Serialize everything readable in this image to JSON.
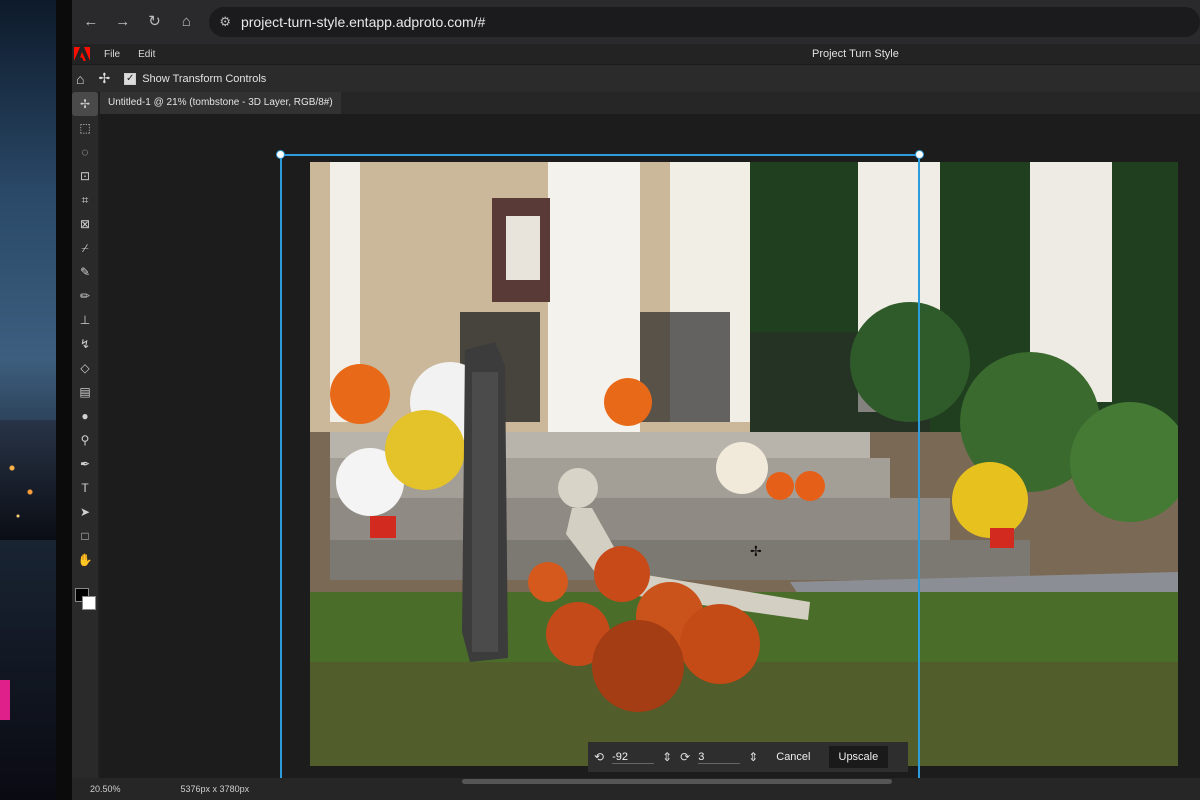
{
  "browser": {
    "url": "project-turn-style.entapp.adproto.com/#",
    "back_icon": "arrow-left-icon",
    "forward_icon": "arrow-right-icon",
    "reload_icon": "reload-icon",
    "home_icon": "home-icon"
  },
  "menubar": {
    "items": [
      {
        "label": "File"
      },
      {
        "label": "Edit"
      }
    ],
    "title": "Project Turn Style"
  },
  "options": {
    "show_transform_label": "Show Transform Controls",
    "show_transform_checked": true
  },
  "document": {
    "tab_label": "Untitled-1 @ 21% (tombstone - 3D Layer, RGB/8#)"
  },
  "tools": [
    {
      "name": "move-tool",
      "glyph": "✢"
    },
    {
      "name": "marquee-tool",
      "glyph": "⬚"
    },
    {
      "name": "lasso-tool",
      "glyph": "◌"
    },
    {
      "name": "object-select-tool",
      "glyph": "⊡"
    },
    {
      "name": "crop-tool",
      "glyph": "⌗"
    },
    {
      "name": "frame-tool",
      "glyph": "⊠"
    },
    {
      "name": "eyedropper-tool",
      "glyph": "⌿"
    },
    {
      "name": "healing-tool",
      "glyph": "✎"
    },
    {
      "name": "brush-tool",
      "glyph": "✏"
    },
    {
      "name": "stamp-tool",
      "glyph": "⊥"
    },
    {
      "name": "history-brush-tool",
      "glyph": "↯"
    },
    {
      "name": "eraser-tool",
      "glyph": "◇"
    },
    {
      "name": "gradient-tool",
      "glyph": "▤"
    },
    {
      "name": "blur-tool",
      "glyph": "●"
    },
    {
      "name": "dodge-tool",
      "glyph": "⚲"
    },
    {
      "name": "pen-tool",
      "glyph": "✒"
    },
    {
      "name": "type-tool",
      "glyph": "T"
    },
    {
      "name": "path-select-tool",
      "glyph": "➤"
    },
    {
      "name": "shape-tool",
      "glyph": "□"
    },
    {
      "name": "hand-tool",
      "glyph": "✋"
    }
  ],
  "transform_bar": {
    "rotate_value": "-92",
    "scale_value": "3",
    "cancel_label": "Cancel",
    "upscale_label": "Upscale"
  },
  "status": {
    "zoom": "20.50%",
    "dimensions": "5376px x 3780px"
  }
}
